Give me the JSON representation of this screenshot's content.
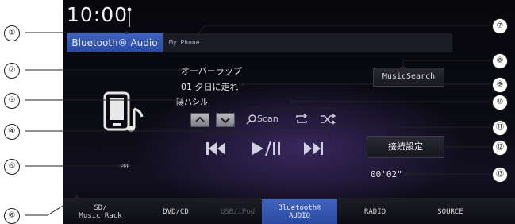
{
  "screen": {
    "clock": "10:00",
    "tabs": {
      "active": "Bluetooth® Audio",
      "inactive": "My Phone"
    },
    "track": {
      "album": "オーバーラップ",
      "title": "01 夕日に走れ",
      "artist": "陽ハシル"
    },
    "buttons": {
      "music_search": "MusicSearch",
      "connection_settings": "接続設定"
    },
    "controls": {
      "scan_label": "Scan"
    },
    "elapsed": "00'02\"",
    "small_text": "ppp"
  },
  "bottom_tabs": [
    {
      "label": "SD/\nMusic Rack",
      "state": "normal"
    },
    {
      "label": "DVD/CD",
      "state": "normal"
    },
    {
      "label": "USB/iPod",
      "state": "disabled"
    },
    {
      "label": "Bluetooth®\nAUDIO",
      "state": "active"
    },
    {
      "label": "RADIO",
      "state": "normal"
    },
    {
      "label": "SOURCE",
      "state": "normal"
    }
  ],
  "callouts": [
    "①",
    "②",
    "③",
    "④",
    "⑤",
    "⑥",
    "⑦",
    "⑧",
    "⑨",
    "⑩",
    "⑪",
    "⑫",
    "⑬"
  ],
  "colors": {
    "accent": "#2f55b3",
    "background": "#0a0a10",
    "text": "#e8e8e8"
  }
}
